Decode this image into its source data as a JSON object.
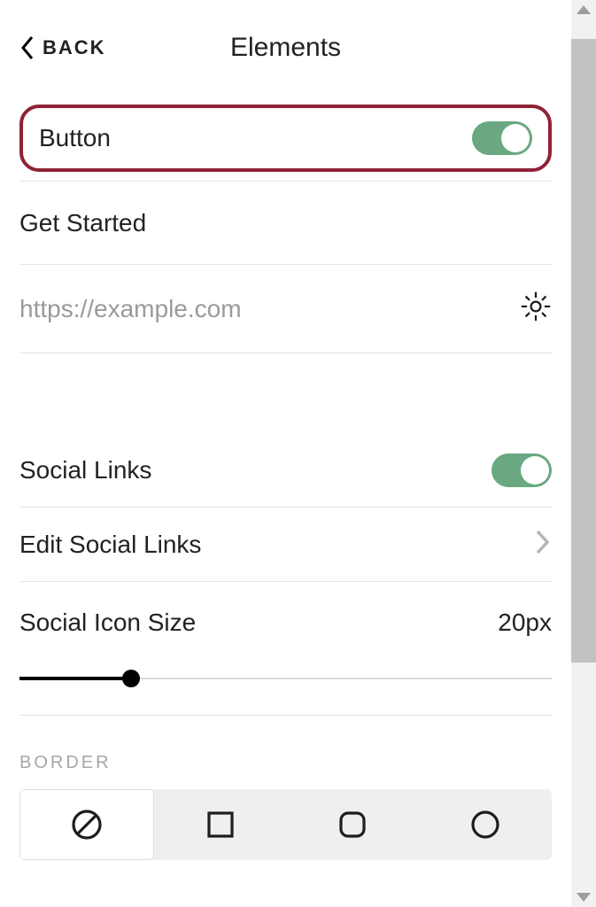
{
  "header": {
    "back": "BACK",
    "title": "Elements"
  },
  "button_section": {
    "label": "Button",
    "text_value": "Get Started",
    "url_placeholder": "https://example.com"
  },
  "social": {
    "links_label": "Social Links",
    "edit_label": "Edit Social Links",
    "icon_size_label": "Social Icon Size",
    "icon_size_value": "20px"
  },
  "border": {
    "section_label": "BORDER",
    "options": [
      "none",
      "square",
      "rounded",
      "circle"
    ],
    "selected": "none"
  }
}
